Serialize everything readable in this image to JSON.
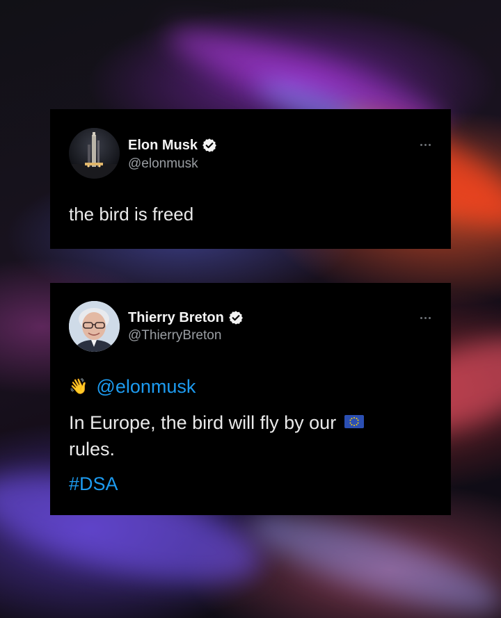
{
  "tweets": [
    {
      "author": "Elon Musk",
      "handle": "@elonmusk",
      "verified": true,
      "avatar_icon": "rocket-launch-photo",
      "text": "the bird is freed"
    },
    {
      "author": "Thierry Breton",
      "handle": "@ThierryBreton",
      "verified": true,
      "avatar_icon": "portrait-photo",
      "wave_emoji": "👋",
      "mention": "@elonmusk",
      "text": "In Europe, the bird will fly by our",
      "text_end": "rules.",
      "flag_icon": "eu-flag-icon",
      "hashtag": "#DSA"
    }
  ],
  "colors": {
    "card_background": "#000000",
    "link": "#1d9bf0",
    "handle": "#9a9ea3",
    "text": "#eaeaea"
  }
}
